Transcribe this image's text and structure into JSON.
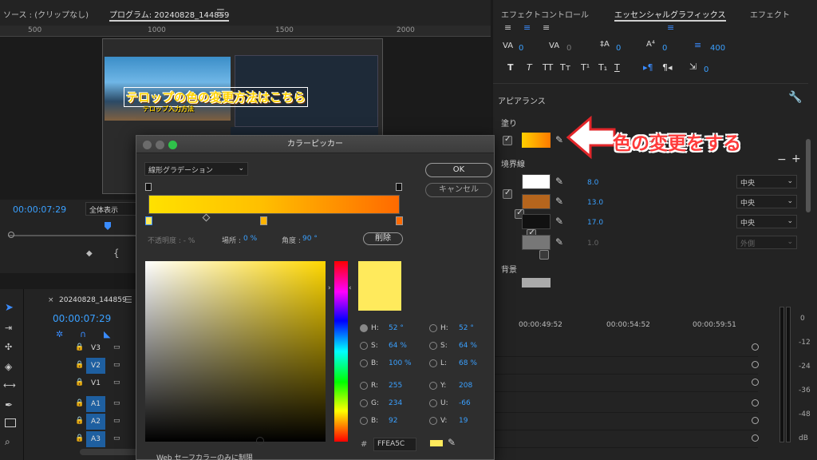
{
  "source": {
    "tab": "ソース : (クリップなし)"
  },
  "program": {
    "tab": "プログラム: 20240828_144859",
    "menu_icon": "hamburger-icon",
    "ruler_ticks": [
      "500",
      "1000",
      "1500",
      "2000"
    ],
    "overlay_title": "テロップの色の変更方法はこちら",
    "overlay_sub": "テロップ入力方法",
    "timecode": "00:00:07:29",
    "zoom": "全体表示"
  },
  "right_panel": {
    "tabs": [
      "エフェクトコントロール",
      "エッセンシャルグラフィックス",
      "エフェクト"
    ],
    "tracking_values": [
      "0",
      "0",
      "0",
      "0",
      "400"
    ],
    "text_style_buttons": [
      "T",
      "T",
      "TT",
      "Tт",
      "T¹",
      "T₁",
      "T"
    ],
    "para_value": "0",
    "appearance_label": "アピアランス",
    "fill_label": "塗り",
    "stroke_label": "境界線",
    "strokes": [
      {
        "checked": true,
        "color": "#ffffff",
        "width": "8.0",
        "position": "中央"
      },
      {
        "checked": true,
        "color": "#b5651d",
        "width": "13.0",
        "position": "中央"
      },
      {
        "checked": true,
        "color": "#111111",
        "width": "17.0",
        "position": "中央"
      },
      {
        "checked": false,
        "color": "#777777",
        "width": "1.0",
        "position": "外側"
      }
    ],
    "background_label": "背景",
    "annotation": "色の変更をする"
  },
  "color_picker": {
    "title": "カラーピッカー",
    "gradient_type": "線形グラデーション",
    "ok": "OK",
    "cancel": "キャンセル",
    "opacity_label": "不透明度 : - %",
    "location_label": "場所 :",
    "location_value": "0 %",
    "angle_label": "角度 :",
    "angle_value": "90 °",
    "delete": "削除",
    "hsb": [
      {
        "label": "H:",
        "value": "52 °",
        "on": true
      },
      {
        "label": "S:",
        "value": "64 %",
        "on": false
      },
      {
        "label": "B:",
        "value": "100 %",
        "on": false
      },
      {
        "label": "R:",
        "value": "255",
        "on": false
      },
      {
        "label": "G:",
        "value": "234",
        "on": false
      },
      {
        "label": "B:",
        "value": "92",
        "on": false
      }
    ],
    "hsl": [
      {
        "label": "H:",
        "value": "52 °"
      },
      {
        "label": "S:",
        "value": "64 %"
      },
      {
        "label": "L:",
        "value": "68 %"
      },
      {
        "label": "Y:",
        "value": "208"
      },
      {
        "label": "U:",
        "value": "-66"
      },
      {
        "label": "V:",
        "value": "19"
      }
    ],
    "hex_prefix": "#",
    "hex": "FFEA5C",
    "web_safe": "Web セーフカラーのみに制限",
    "swatch_color": "#ffea5c"
  },
  "timeline": {
    "tab": "20240828_144859",
    "timecode": "00:00:07:29",
    "ruler": [
      "00:00:49:52",
      "00:00:54:52",
      "00:00:59:51"
    ],
    "tracks": [
      "V3",
      "V2",
      "V1",
      "A1",
      "A2",
      "A3"
    ]
  },
  "meter": {
    "labels": [
      "0",
      "-12",
      "-24",
      "-36",
      "-48",
      "dB"
    ]
  }
}
